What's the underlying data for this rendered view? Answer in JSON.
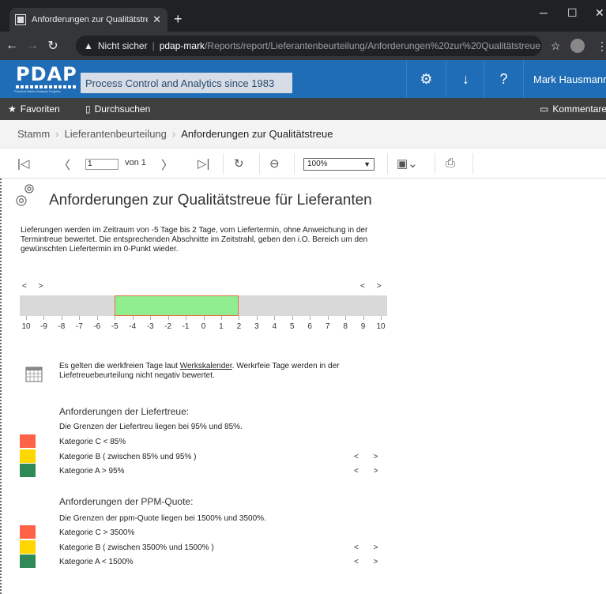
{
  "browser": {
    "tab_title": "Anforderungen zur Qualitätstreu",
    "new_tab": "+",
    "security_label": "Nicht sicher",
    "url_host": "pdap-mark",
    "url_path": "/Reports/report/Lieferantenbeurteilung/Anforderungen%20zur%20Qualitätstreue"
  },
  "app": {
    "logo_text": "PDAP",
    "logo_sub": "Practical Better Analysis Projekte",
    "tagline": "Process Control and Analytics since 1983",
    "user": "Mark Hausmann"
  },
  "menubar": {
    "favorites": "Favoriten",
    "browse": "Durchsuchen",
    "comments": "Kommentare"
  },
  "breadcrumb": {
    "items": [
      "Stamm",
      "Lieferantenbeurteilung",
      "Anforderungen zur Qualitätstreue"
    ]
  },
  "toolbar": {
    "page_value": "1",
    "page_of": "von 1",
    "zoom": "100%"
  },
  "report": {
    "title": "Anforderungen zur Qualitätstreue für Lieferanten",
    "intro": "Lieferungen werden im Zeitraum von -5 Tage bis 2 Tage, vom Liefertermin, ohne Anweichung in der Termintreue bewertet. Die entsprechenden Abschnitte im Zeitstrahl, geben den i.O. Bereich um den gewünschten Liefertermin im 0-Punkt wieder.",
    "arrows_left": "< >",
    "arrows_right": "< >",
    "timeline": {
      "ticks": [
        "10",
        "-9",
        "-8",
        "-7",
        "-6",
        "-5",
        "-4",
        "-3",
        "-2",
        "-1",
        "0",
        "1",
        "2",
        "3",
        "4",
        "5",
        "6",
        "7",
        "8",
        "9",
        "10"
      ],
      "tick_values": [
        -10,
        -9,
        -8,
        -7,
        -6,
        -5,
        -4,
        -3,
        -2,
        -1,
        0,
        1,
        2,
        3,
        4,
        5,
        6,
        7,
        8,
        9,
        10
      ],
      "ok_start": -5,
      "ok_end": 2,
      "ok_color": "#90ee90",
      "bar_color": "#d9d9d9"
    },
    "calendar_text_before": "Es gelten die werkfreien Tage laut ",
    "calendar_link": "Werkskalender",
    "calendar_text_after": ". Werkrfeie Tage werden in der Liefetreuebeurteilung nicht negativ bewertet.",
    "liefertreue": {
      "heading": "Anforderungen der Liefertreue:",
      "desc": "Die Grenzen der Liefertreu liegen bei 95% und 85%.",
      "categories": [
        {
          "label": "Kategorie C  < 85%",
          "color": "#ff6347",
          "arrows": ""
        },
        {
          "label": "Kategorie B  ( zwischen 85% und 95% )",
          "color": "#ffd700",
          "arrows": "< >"
        },
        {
          "label": "Kategorie A  > 95%",
          "color": "#2e8b57",
          "arrows": "< >"
        }
      ]
    },
    "ppm": {
      "heading": "Anforderungen der PPM-Quote:",
      "desc": "Die Grenzen der ppm-Quote liegen bei 1500% und 3500%.",
      "categories": [
        {
          "label": "Kategorie C  > 3500%",
          "color": "#ff6347",
          "arrows": ""
        },
        {
          "label": "Kategorie B  ( zwischen 3500% und 1500% )",
          "color": "#ffd700",
          "arrows": "< >"
        },
        {
          "label": "Kategorie A  < 1500%",
          "color": "#2e8b57",
          "arrows": "< >"
        }
      ]
    }
  },
  "icons": [
    "app-icon",
    "close-icon",
    "back-icon",
    "forward-icon",
    "reload-icon",
    "warning-icon",
    "star-icon",
    "settings-gear-icon",
    "download-icon",
    "help-icon",
    "folder-icon",
    "comment-icon",
    "first-page-icon",
    "prev-page-icon",
    "next-page-icon",
    "last-page-icon",
    "refresh-icon",
    "back-circle-icon",
    "save-icon",
    "print-icon",
    "gear-icon",
    "calendar-icon"
  ]
}
